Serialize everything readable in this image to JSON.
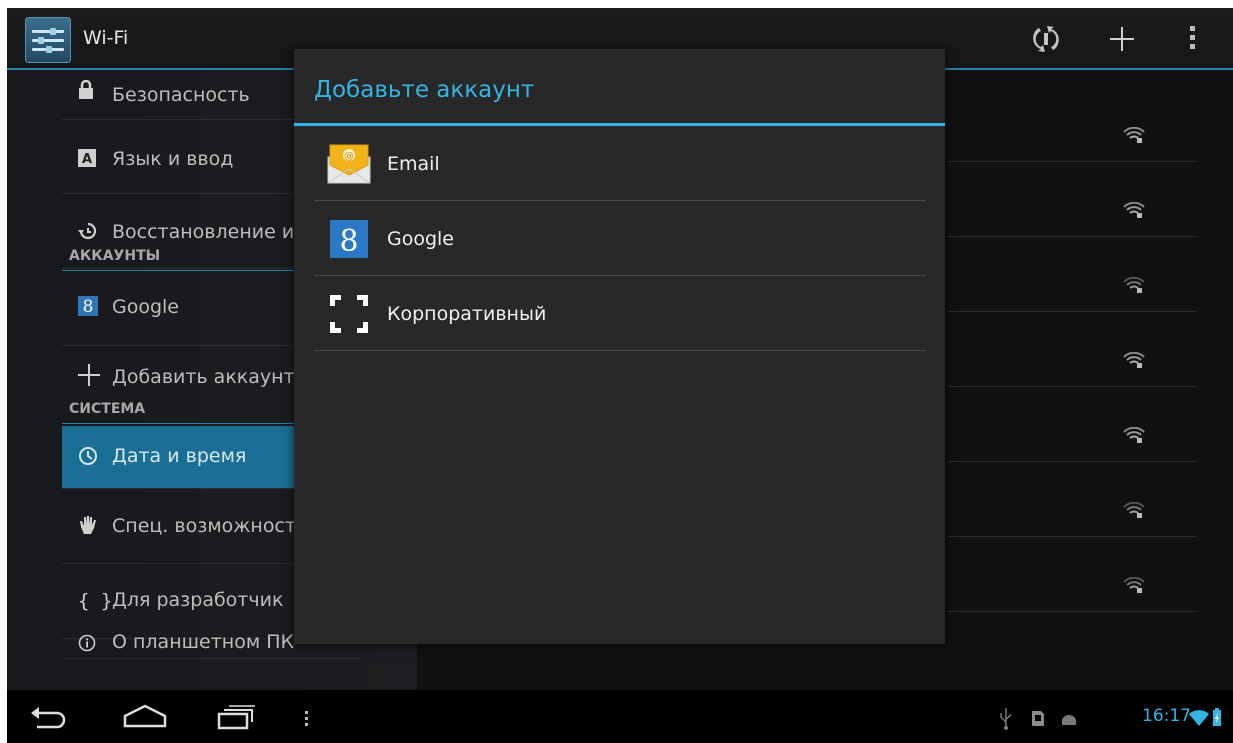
{
  "action_bar": {
    "title": "Wi-Fi",
    "scan_icon": "wps-icon",
    "add_icon": "plus-icon",
    "overflow_icon": "overflow-menu-icon"
  },
  "settings": {
    "items_top": [
      {
        "label": "Безопасность",
        "icon": "lock-icon"
      },
      {
        "label": "Язык и ввод",
        "icon": "keyboard-letter-icon"
      },
      {
        "label": "Восстановление и",
        "icon": "restore-icon"
      }
    ],
    "header_accounts": "АККАУНТЫ",
    "accounts": [
      {
        "label": "Google",
        "icon": "google-icon"
      },
      {
        "label": "Добавить аккаунт",
        "icon": "plus-icon"
      }
    ],
    "header_system": "СИСТЕМА",
    "system": [
      {
        "label": "Дата и время",
        "icon": "clock-icon",
        "selected": true
      },
      {
        "label": "Спец. возможност",
        "icon": "hand-icon"
      },
      {
        "label": "Для разработчик",
        "icon": "braces-icon"
      },
      {
        "label": "О планшетном ПК",
        "icon": "info-icon"
      }
    ]
  },
  "wifi_list": {
    "count": 7,
    "icon": "wifi-signal-locked-icon"
  },
  "dialog": {
    "title": "Добавьте аккаунт",
    "options": [
      {
        "label": "Email",
        "icon": "email-envelope-icon"
      },
      {
        "label": "Google",
        "icon": "google-icon"
      },
      {
        "label": "Корпоративный",
        "icon": "corporate-exchange-icon"
      }
    ]
  },
  "status_bar": {
    "time": "16:17",
    "icons": [
      "usb-icon",
      "sd-card-icon",
      "android-debug-icon",
      "wifi-icon",
      "battery-icon"
    ]
  },
  "colors": {
    "accent": "#33b5e5",
    "selected": "#1b6e95"
  }
}
